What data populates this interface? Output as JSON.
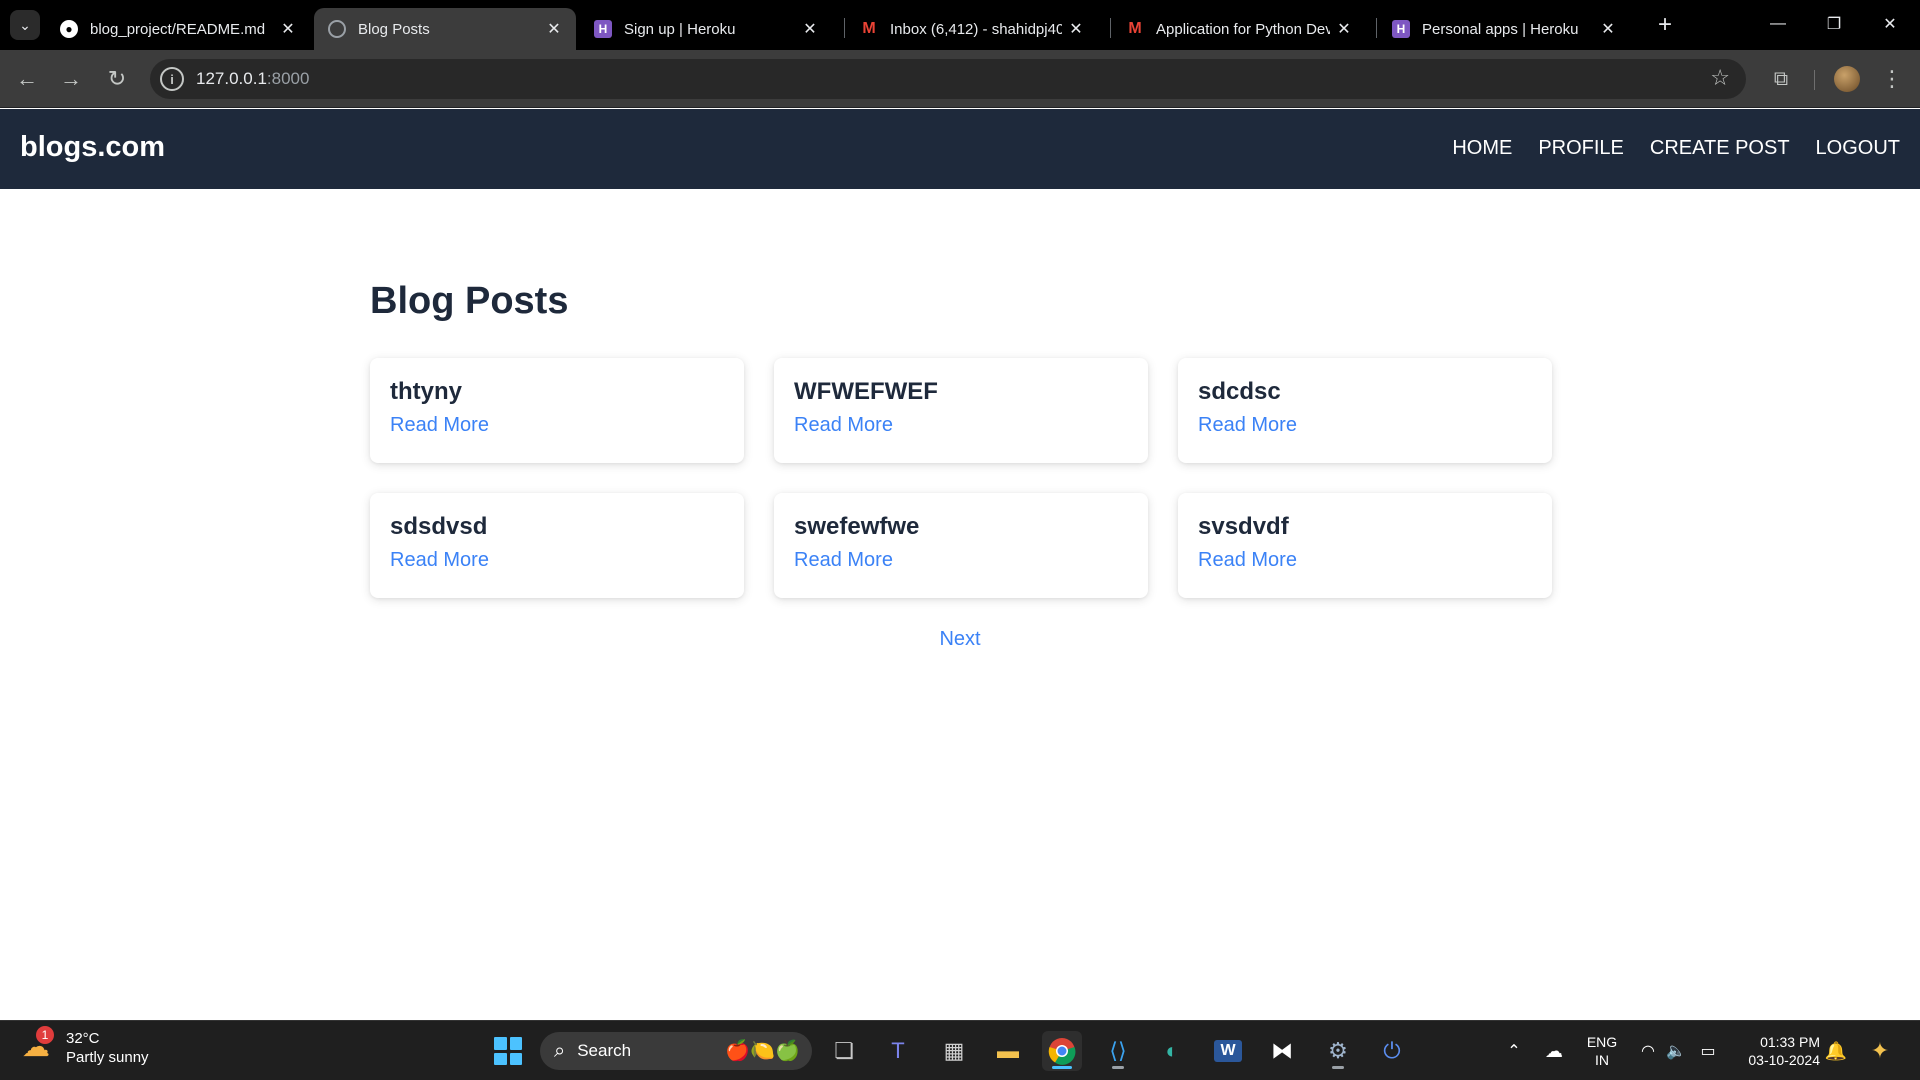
{
  "browser": {
    "tabs": [
      {
        "title": "blog_project/README.md",
        "favicon": "github-icon"
      },
      {
        "title": "Blog Posts",
        "favicon": "globe-icon",
        "active": true
      },
      {
        "title": "Sign up | Heroku",
        "favicon": "heroku-icon"
      },
      {
        "title": "Inbox (6,412) - shahidpj40",
        "favicon": "gmail-icon"
      },
      {
        "title": "Application for Python Dev",
        "favicon": "gmail-icon"
      },
      {
        "title": "Personal apps | Heroku",
        "favicon": "heroku-icon"
      }
    ],
    "url_host": "127.0.0.1",
    "url_port": ":8000"
  },
  "site": {
    "brand": "blogs.com",
    "nav": [
      {
        "label": "HOME"
      },
      {
        "label": "PROFILE"
      },
      {
        "label": "CREATE POST"
      },
      {
        "label": "LOGOUT"
      }
    ],
    "page_title": "Blog Posts",
    "posts": [
      {
        "title": "thtyny",
        "link": "Read More"
      },
      {
        "title": "WFWEFWEF",
        "link": "Read More"
      },
      {
        "title": "sdcdsc",
        "link": "Read More"
      },
      {
        "title": "sdsdvsd",
        "link": "Read More"
      },
      {
        "title": "swefewfwe",
        "link": "Read More"
      },
      {
        "title": "svsdvdf",
        "link": "Read More"
      }
    ],
    "pagination_next": "Next",
    "colors": {
      "navbar": "#1e293b",
      "link": "#3b82f6",
      "heading": "#1e293b"
    }
  },
  "taskbar": {
    "weather_badge": "1",
    "weather_temp": "32°C",
    "weather_desc": "Partly sunny",
    "search_label": "Search",
    "lang_top": "ENG",
    "lang_bottom": "IN",
    "time": "01:33 PM",
    "date": "03-10-2024"
  }
}
